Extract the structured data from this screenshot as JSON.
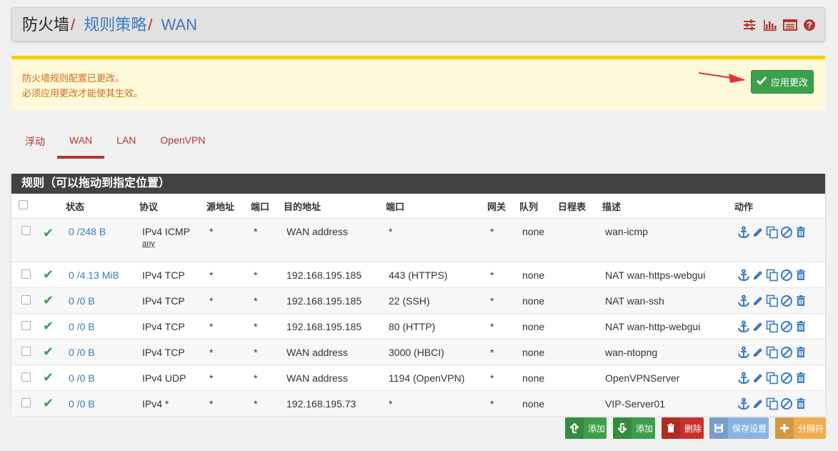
{
  "breadcrumb": {
    "root": "防火墙",
    "mid": "规则策略",
    "current": "WAN",
    "sep": "/"
  },
  "titlebar_icons": [
    "sliders-icon",
    "bar-chart-icon",
    "list-icon",
    "help-icon"
  ],
  "notice": {
    "line1": "防火墙规则配置已更改。",
    "line2": "必须应用更改才能使其生效。",
    "apply_label": "应用更改"
  },
  "tabs": [
    {
      "label": "浮动",
      "active": false
    },
    {
      "label": "WAN",
      "active": true
    },
    {
      "label": "LAN",
      "active": false
    },
    {
      "label": "OpenVPN",
      "active": false
    }
  ],
  "panel": {
    "title": "规则（可以拖动到指定位置）"
  },
  "columns": [
    "状态",
    "协议",
    "源地址",
    "端口",
    "目的地址",
    "端口",
    "网关",
    "队列",
    "日程表",
    "描述",
    "动作"
  ],
  "rows": [
    {
      "states": "0 /248 B",
      "protocol": "IPv4 ICMP",
      "protocol_sub": "any",
      "source": "*",
      "sport": "*",
      "dest": "WAN address",
      "dport": "*",
      "gateway": "*",
      "queue": "none",
      "schedule": "",
      "desc": "wan-icmp"
    },
    {
      "states": "0 /4.13 MiB",
      "protocol": "IPv4 TCP",
      "protocol_sub": "",
      "source": "*",
      "sport": "*",
      "dest": "192.168.195.185",
      "dport": "443 (HTTPS)",
      "gateway": "*",
      "queue": "none",
      "schedule": "",
      "desc": "NAT wan-https-webgui"
    },
    {
      "states": "0 /0 B",
      "protocol": "IPv4 TCP",
      "protocol_sub": "",
      "source": "*",
      "sport": "*",
      "dest": "192.168.195.185",
      "dport": "22 (SSH)",
      "gateway": "*",
      "queue": "none",
      "schedule": "",
      "desc": "NAT wan-ssh"
    },
    {
      "states": "0 /0 B",
      "protocol": "IPv4 TCP",
      "protocol_sub": "",
      "source": "*",
      "sport": "*",
      "dest": "192.168.195.185",
      "dport": "80 (HTTP)",
      "gateway": "*",
      "queue": "none",
      "schedule": "",
      "desc": "NAT wan-http-webgui"
    },
    {
      "states": "0 /0 B",
      "protocol": "IPv4 TCP",
      "protocol_sub": "",
      "source": "*",
      "sport": "*",
      "dest": "WAN address",
      "dport": "3000 (HBCI)",
      "gateway": "*",
      "queue": "none",
      "schedule": "",
      "desc": "wan-ntopng"
    },
    {
      "states": "0 /0 B",
      "protocol": "IPv4 UDP",
      "protocol_sub": "",
      "source": "*",
      "sport": "*",
      "dest": "WAN address",
      "dport": "1194 (OpenVPN)",
      "gateway": "*",
      "queue": "none",
      "schedule": "",
      "desc": "OpenVPNServer"
    },
    {
      "states": "0 /0 B",
      "protocol": "IPv4 *",
      "protocol_sub": "",
      "source": "*",
      "sport": "*",
      "dest": "192.168.195.73",
      "dport": "*",
      "gateway": "*",
      "queue": "none",
      "schedule": "",
      "desc": "VIP-Server01"
    }
  ],
  "buttons": {
    "add_top": "添加",
    "add_bottom": "添加",
    "delete": "删除",
    "save": "保存设置",
    "separator": "分隔符"
  },
  "colors": {
    "accent_red": "#b3362f",
    "link_blue": "#3a7abf",
    "success_green": "#3d9f4c",
    "notice_yellow": "#f8cf09",
    "danger": "#c9302c",
    "save_blue": "#8ab4e0",
    "warning": "#f0ad4e"
  }
}
